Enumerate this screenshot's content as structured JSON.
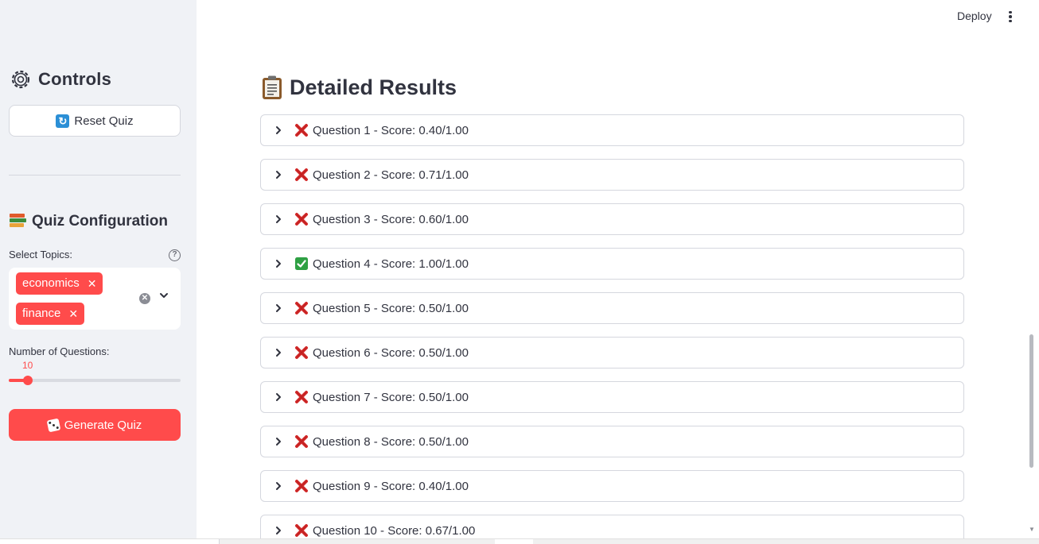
{
  "sidebar": {
    "controls_title": "Controls",
    "reset_label": "Reset Quiz",
    "config_title": "Quiz Configuration",
    "topics_label": "Select Topics:",
    "topics": [
      "economics",
      "finance"
    ],
    "num_questions_label": "Number of Questions:",
    "num_questions_value": "10",
    "num_questions_fraction": 0.11,
    "generate_label": "Generate Quiz"
  },
  "header": {
    "deploy_label": "Deploy"
  },
  "main": {
    "title": "Detailed Results",
    "results": [
      {
        "label": "Question 1 - Score: 0.40/1.00",
        "status": "wrong"
      },
      {
        "label": "Question 2 - Score: 0.71/1.00",
        "status": "wrong"
      },
      {
        "label": "Question 3 - Score: 0.60/1.00",
        "status": "wrong"
      },
      {
        "label": "Question 4 - Score: 1.00/1.00",
        "status": "correct"
      },
      {
        "label": "Question 5 - Score: 0.50/1.00",
        "status": "wrong"
      },
      {
        "label": "Question 6 - Score: 0.50/1.00",
        "status": "wrong"
      },
      {
        "label": "Question 7 - Score: 0.50/1.00",
        "status": "wrong"
      },
      {
        "label": "Question 8 - Score: 0.50/1.00",
        "status": "wrong"
      },
      {
        "label": "Question 9 - Score: 0.40/1.00",
        "status": "wrong"
      },
      {
        "label": "Question 10 - Score: 0.67/1.00",
        "status": "wrong"
      }
    ]
  },
  "colors": {
    "accent": "#ff4b4b",
    "sidebar_bg": "#f0f2f6",
    "text": "#31333f",
    "correct": "#2ea043",
    "wrong": "#d42a2a"
  }
}
